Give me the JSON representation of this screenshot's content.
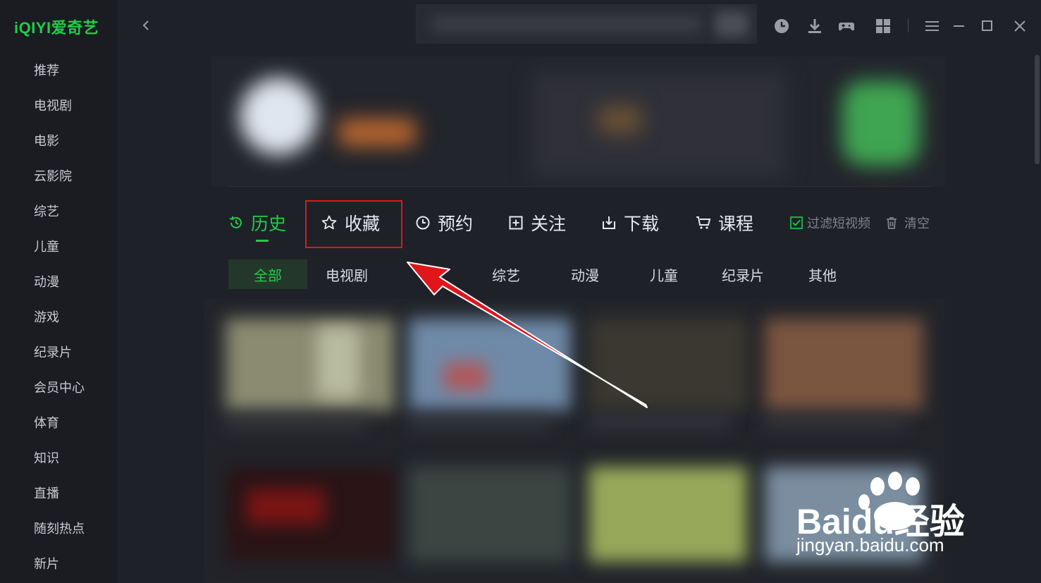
{
  "app": {
    "logo_text": "iQIYI爱奇艺",
    "brand_color": "#1fce49"
  },
  "sidebar": {
    "items": [
      {
        "label": "推荐"
      },
      {
        "label": "电视剧"
      },
      {
        "label": "电影"
      },
      {
        "label": "云影院"
      },
      {
        "label": "综艺"
      },
      {
        "label": "儿童"
      },
      {
        "label": "动漫"
      },
      {
        "label": "游戏"
      },
      {
        "label": "纪录片"
      },
      {
        "label": "会员中心"
      },
      {
        "label": "体育"
      },
      {
        "label": "知识"
      },
      {
        "label": "直播"
      },
      {
        "label": "随刻热点"
      },
      {
        "label": "新片"
      }
    ]
  },
  "toolbar": {
    "icons": [
      "history-icon",
      "download-icon",
      "gamepad-icon",
      "apps-grid-icon",
      "menu-icon",
      "minimize-icon",
      "maximize-icon",
      "close-icon"
    ]
  },
  "tabs": {
    "history": "历史",
    "favorites": "收藏",
    "reservations": "预约",
    "follow": "关注",
    "download": "下载",
    "courses": "课程",
    "filter_short_video": "过滤短视频",
    "clear": "清空",
    "active": "history"
  },
  "categories": [
    {
      "label": "全部",
      "active": true
    },
    {
      "label": "电视剧",
      "active": false
    },
    {
      "label": "",
      "active": false
    },
    {
      "label": "综艺",
      "active": false
    },
    {
      "label": "动漫",
      "active": false
    },
    {
      "label": "儿童",
      "active": false
    },
    {
      "label": "纪录片",
      "active": false
    },
    {
      "label": "其他",
      "active": false
    }
  ],
  "annotation": {
    "highlight_color": "#e0161b"
  },
  "watermark": {
    "brand": "Baidu经验",
    "url": "jingyan.baidu.com"
  }
}
